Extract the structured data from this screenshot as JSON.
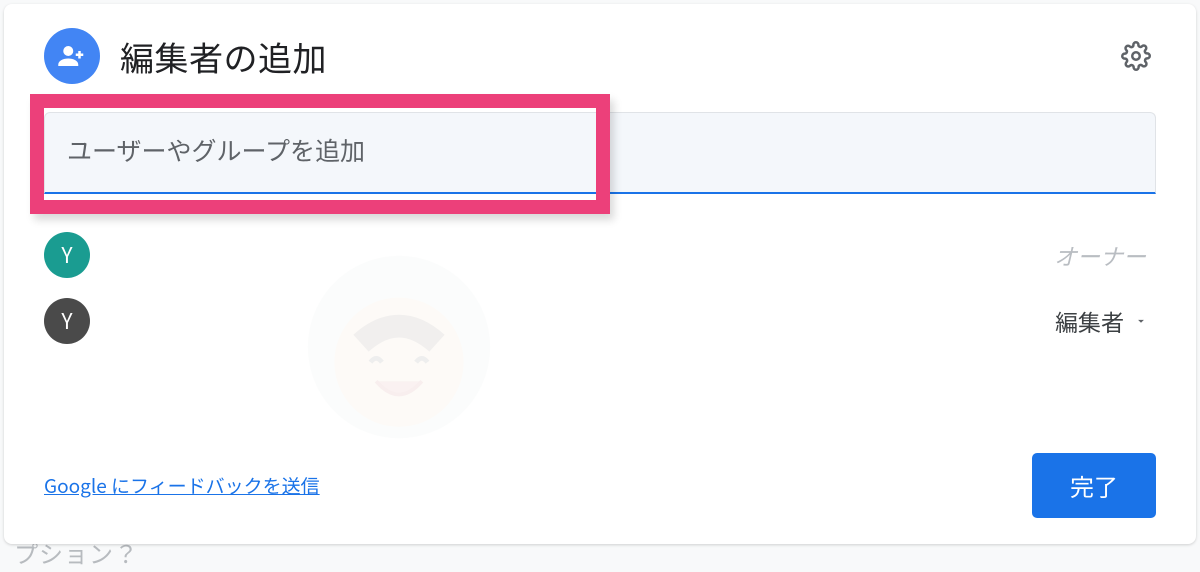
{
  "dialog": {
    "title": "編集者の追加",
    "input_placeholder": "ユーザーやグループを追加"
  },
  "users": [
    {
      "initial": "Y",
      "avatar_color": "teal",
      "role": "オーナー",
      "role_type": "owner"
    },
    {
      "initial": "Y",
      "avatar_color": "dark",
      "role": "編集者",
      "role_type": "editor"
    }
  ],
  "footer": {
    "feedback": "Google にフィードバックを送信",
    "done": "完了"
  },
  "background_text": "プション？"
}
